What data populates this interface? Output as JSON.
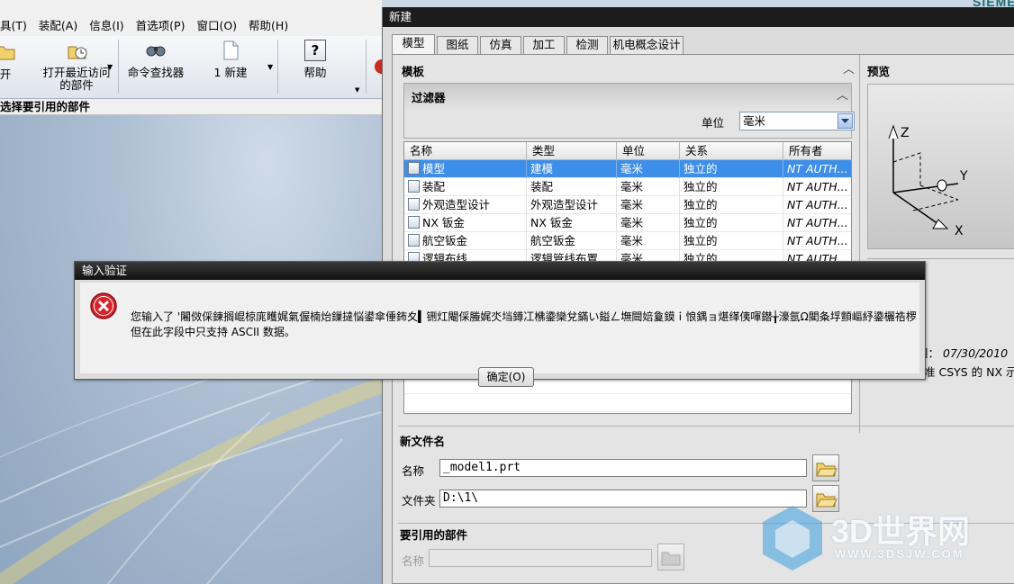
{
  "main_window": {
    "brand": "SIEMENS",
    "menu": [
      "具(T)",
      "装配(A)",
      "信息(I)",
      "首选项(P)",
      "窗口(O)",
      "帮助(H)"
    ],
    "toolbar": {
      "open_label": "开",
      "recent_label_line1": "打开最近访问",
      "recent_label_line2": "的部件",
      "finder_label": "命令查找器",
      "new_label": "1 新建",
      "help_label": "帮助",
      "help_icon_text": "?"
    },
    "selection_bar": "选择要引用的部件"
  },
  "new_dialog": {
    "title": "新建",
    "tabs": [
      "模型",
      "图纸",
      "仿真",
      "加工",
      "检测",
      "机电概念设计"
    ],
    "template_header": "模板",
    "filter_header": "过滤器",
    "unit_label": "单位",
    "unit_value": "毫米",
    "table": {
      "columns": [
        "名称",
        "类型",
        "单位",
        "关系",
        "所有者"
      ],
      "rows": [
        {
          "name": "模型",
          "type": "建模",
          "unit": "毫米",
          "relation": "独立的",
          "owner": "NT AUTH...",
          "selected": true
        },
        {
          "name": "装配",
          "type": "装配",
          "unit": "毫米",
          "relation": "独立的",
          "owner": "NT AUTH...",
          "selected": false
        },
        {
          "name": "外观造型设计",
          "type": "外观造型设计",
          "unit": "毫米",
          "relation": "独立的",
          "owner": "NT AUTH...",
          "selected": false
        },
        {
          "name": "NX 钣金",
          "type": "NX 钣金",
          "unit": "毫米",
          "relation": "独立的",
          "owner": "NT AUTH...",
          "selected": false
        },
        {
          "name": "航空钣金",
          "type": "航空钣金",
          "unit": "毫米",
          "relation": "独立的",
          "owner": "NT AUTH...",
          "selected": false
        },
        {
          "name": "逻辑布线",
          "type": "逻辑管线布置",
          "unit": "毫米",
          "relation": "独立的",
          "owner": "NT AUTH...",
          "selected": false
        }
      ]
    },
    "preview_header": "预览",
    "axes": {
      "z": "Z",
      "y": "Y",
      "x": "X"
    },
    "props_date_prefix": "间：",
    "props_date": "07/30/2010",
    "props_desc": "准 CSYS 的 NX 示",
    "new_filename_header": "新文件名",
    "name_label": "名称",
    "name_value": "_model1.prt",
    "folder_label": "文件夹",
    "folder_value": "D:\\1\\",
    "ref_parts_header": "要引用的部件",
    "ref_name_label": "名称"
  },
  "error_dialog": {
    "title": "输入验证",
    "message_line1": "您输入了 '闂傚倸鍊搁崐椋庣矆娓氣偓楠炲鏁撻悩鍙傘倕鈽夊▍铏灴閹倸螣娓氼垱鐏冮梻鍌欒兌鏋い鎰ㄥ墲閸婄敻鏌ｉ悢鍝ョ煁缂侇喗鐟╁濠氬Ω閵夈垺顫嶇紓鍌欐祰椤曆囧礄閻ｅ瞼绀婇柛鈩冪☉绾惧綊鏌″搴″箹缂佲偓婢舵劖鐓熼柟閭﹀幗缂嶆垿鏌?悗',",
    "message_line2": "但在此字段中只支持 ASCII 数据。",
    "ok_label": "确定(O)"
  },
  "watermark": {
    "brand": "3D世界网",
    "url": "WWW.3DSJW.COM"
  }
}
